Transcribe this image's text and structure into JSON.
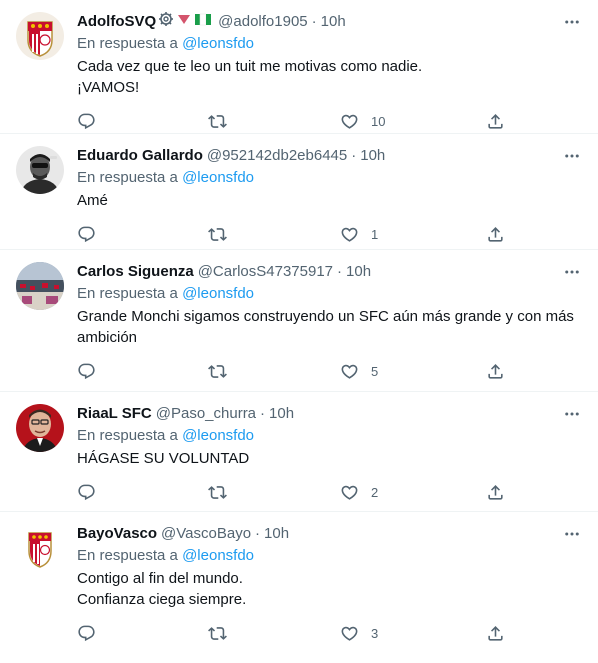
{
  "reply_prefix": "En respuesta a",
  "colors": {
    "accent": "#1d9bf0",
    "secondary_text": "#536471",
    "primary_text": "#0f1419",
    "border": "#eff3f4"
  },
  "icons": {
    "more": "more-horizontal-icon",
    "reply": "reply-icon",
    "retweet": "retweet-icon",
    "like": "heart-icon",
    "share": "share-icon"
  },
  "tweets": [
    {
      "display_name": "AdolfoSVQ",
      "badges": [
        "settings-gear-emoji",
        "red-triangle-emoji",
        "nigeria-flag-emoji"
      ],
      "handle": "@adolfo1905",
      "time": "10h",
      "reply_to": "@leonsfdo",
      "text": "Cada vez que te leo un tuit me motivas como nadie.\n¡VAMOS!",
      "likes": "10"
    },
    {
      "display_name": "Eduardo Gallardo",
      "badges": [],
      "handle": "@952142db2eb6445",
      "time": "10h",
      "reply_to": "@leonsfdo",
      "text": "Amé",
      "likes": "1"
    },
    {
      "display_name": "Carlos Siguenza",
      "badges": [],
      "handle": "@CarlosS47375917",
      "time": "10h",
      "reply_to": "@leonsfdo",
      "text": "Grande Monchi sigamos construyendo un SFC aún más grande y con más ambición",
      "likes": "5"
    },
    {
      "display_name": "RiaaL SFC",
      "badges": [],
      "handle": "@Paso_churra",
      "time": "10h",
      "reply_to": "@leonsfdo",
      "text": "HÁGASE SU VOLUNTAD",
      "likes": "2"
    },
    {
      "display_name": "BayoVasco",
      "badges": [],
      "handle": "@VascoBayo",
      "time": "10h",
      "reply_to": "@leonsfdo",
      "text": "Contigo al fin del mundo.\nConfianza ciega siempre.",
      "likes": "3"
    }
  ]
}
